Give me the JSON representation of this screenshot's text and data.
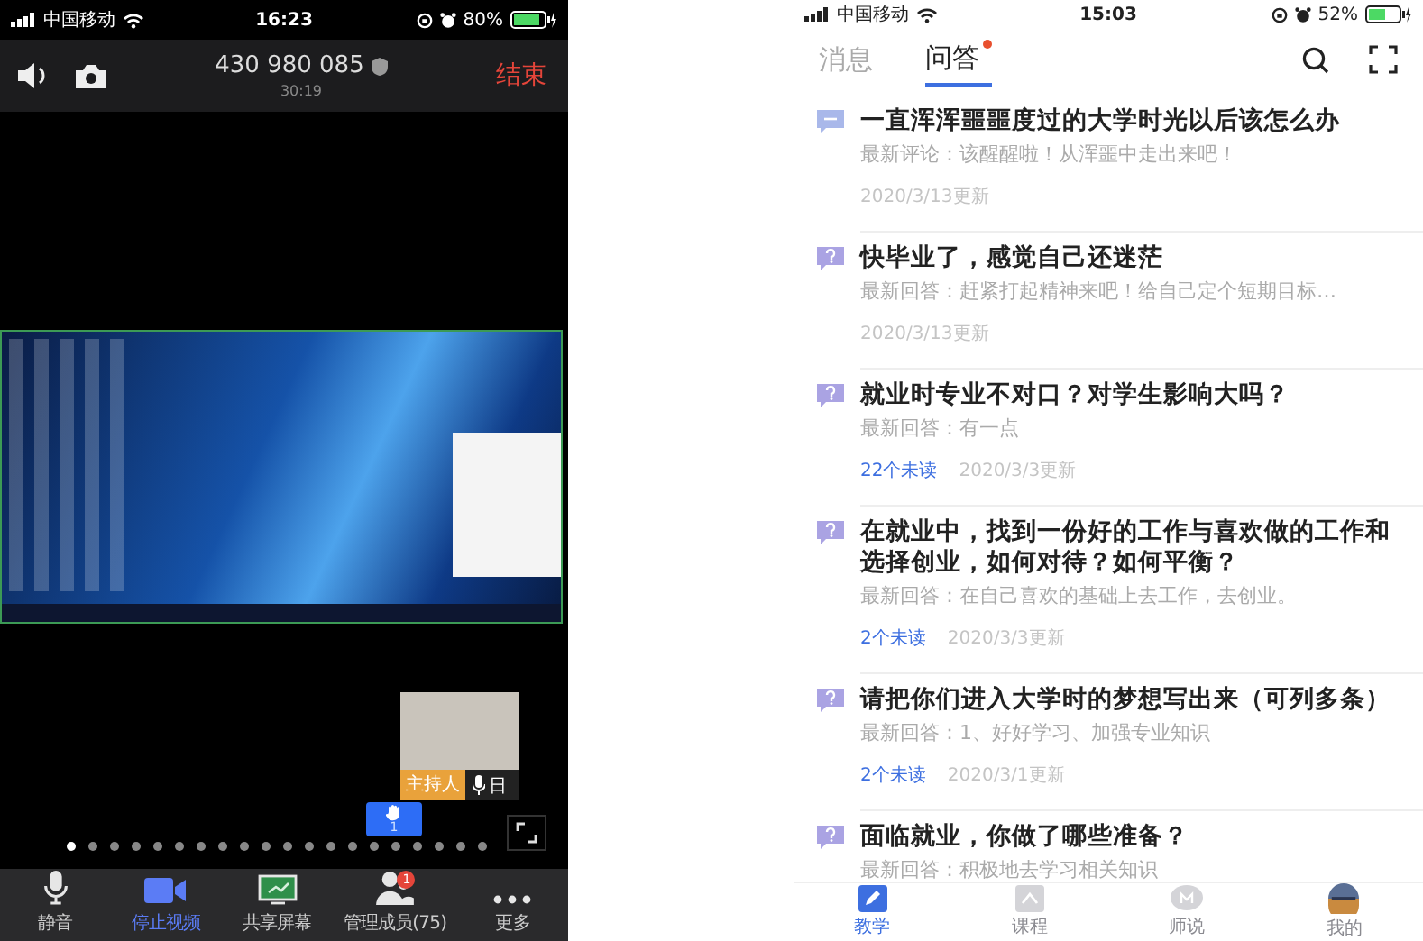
{
  "left_phone": {
    "status_bar": {
      "carrier": "中国移动",
      "time": "16:23",
      "battery": "80%"
    },
    "meeting_header": {
      "meeting_id": "430 980 085",
      "duration": "30:19",
      "end_button": "结束"
    },
    "video_tile": {
      "role_label": "主持人",
      "name": "日"
    },
    "raise_hand": {
      "count": "1"
    },
    "page_dots": [
      {
        "selected": true
      },
      {
        "selected": false
      },
      {
        "selected": false
      },
      {
        "selected": false
      },
      {
        "selected": false
      },
      {
        "selected": false
      },
      {
        "selected": false
      },
      {
        "selected": false
      },
      {
        "selected": false
      },
      {
        "selected": false
      },
      {
        "selected": false
      },
      {
        "selected": false
      },
      {
        "selected": false
      },
      {
        "selected": false
      },
      {
        "selected": false
      },
      {
        "selected": false
      },
      {
        "selected": false
      },
      {
        "selected": false
      },
      {
        "selected": false
      },
      {
        "selected": false
      }
    ],
    "toolbar": [
      {
        "kind": "mic",
        "label": "静音",
        "on": false
      },
      {
        "kind": "video",
        "label": "停止视频",
        "on": true
      },
      {
        "kind": "screen",
        "label": "共享屏幕",
        "on": false
      },
      {
        "kind": "members",
        "label": "管理成员(75)",
        "on": false,
        "badge": "1"
      },
      {
        "kind": "more",
        "label": "更多",
        "on": false
      }
    ]
  },
  "right_phone": {
    "status_bar": {
      "carrier": "中国移动",
      "time": "15:03",
      "battery": "52%"
    },
    "tabs": [
      {
        "label": "消息",
        "selected": false,
        "notification": false
      },
      {
        "label": "问答",
        "selected": true,
        "notification": true
      }
    ],
    "items": [
      {
        "kind": "comment",
        "title": "一直浑浑噩噩度过的大学时光以后该怎么办",
        "reply": "最新评论：该醒醒啦！从浑噩中走出来吧！",
        "updated": "2020/3/13更新"
      },
      {
        "kind": "question",
        "title": "快毕业了，感觉自己还迷茫",
        "reply": "最新回答：赶紧打起精神来吧！给自己定个短期目标…",
        "updated": "2020/3/13更新"
      },
      {
        "kind": "question",
        "title": "就业时专业不对口？对学生影响大吗？",
        "reply": "最新回答：有一点",
        "unread": "22个未读",
        "updated": "2020/3/3更新"
      },
      {
        "kind": "question",
        "title": "在就业中，找到一份好的工作与喜欢做的工作和选择创业，如何对待？如何平衡？",
        "reply": "最新回答：在自己喜欢的基础上去工作，去创业。",
        "unread": "2个未读",
        "updated": "2020/3/3更新"
      },
      {
        "kind": "question",
        "title": "请把你们进入大学时的梦想写出来（可列多条）",
        "reply": "最新回答：1、好好学习、加强专业知识",
        "unread": "2个未读",
        "updated": "2020/3/1更新"
      },
      {
        "kind": "question",
        "title": "面临就业，你做了哪些准备？",
        "reply": "最新回答：积极地去学习相关知识"
      }
    ],
    "bottom_nav": [
      {
        "kind": "teach",
        "label": "教学",
        "selected": true
      },
      {
        "kind": "course",
        "label": "课程",
        "selected": false
      },
      {
        "kind": "talk",
        "label": "师说",
        "selected": false
      },
      {
        "kind": "profile",
        "label": "我的",
        "selected": false
      }
    ]
  }
}
